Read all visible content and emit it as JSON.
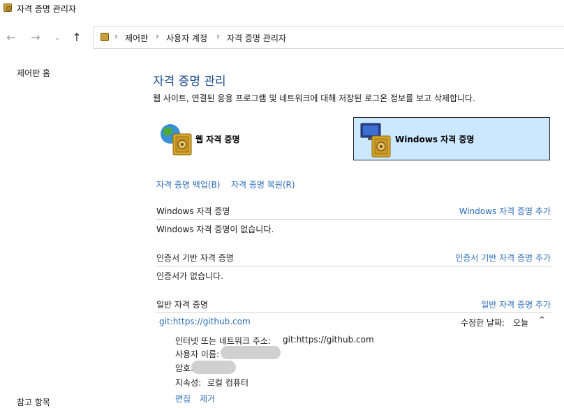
{
  "window": {
    "title": "자격 증명 관리자"
  },
  "nav": {
    "breadcrumb": [
      "제어판",
      "사용자 계정",
      "자격 증명 관리자"
    ]
  },
  "sidebar": {
    "home": "제어판 홈",
    "bottom_partial": "참고 항목"
  },
  "main": {
    "title": "자격 증명 관리",
    "description": "웹 사이트, 연결된 응용 프로그램 및 네트워크에 대해 저장된 로그온 정보를 보고 삭제합니다.",
    "cards": {
      "web": "웹 자격 증명",
      "windows": "Windows 자격 증명"
    },
    "actions": {
      "backup": "자격 증명 백업(B)",
      "restore": "자격 증명 복원(R)"
    },
    "sections": {
      "windows": {
        "title": "Windows 자격 증명",
        "add": "Windows 자격 증명 추가",
        "empty": "Windows 자격 증명이 없습니다."
      },
      "certificate": {
        "title": "인증서 기반 자격 증명",
        "add": "인증서 기반 자격 증명 추가",
        "empty": "인증서가 없습니다."
      },
      "generic": {
        "title": "일반 자격 증명",
        "add": "일반 자격 증명 추가"
      }
    },
    "entry": {
      "name": "git:https://github.com",
      "modified_label": "수정한 날짜:",
      "modified_value": "오늘",
      "address_label": "인터넷 또는 네트워크 주소:",
      "address_value": "git:https://github.com",
      "username_label": "사용자 이름:",
      "password_label": "암호:",
      "persistence_label": "지속성:",
      "persistence_value": "로컬 컴퓨터",
      "edit": "편집",
      "remove": "제거"
    }
  }
}
